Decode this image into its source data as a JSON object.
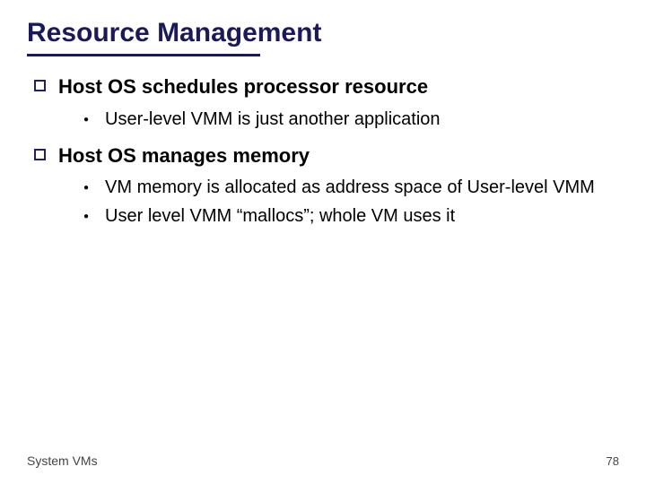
{
  "title": "Resource Management",
  "bullets": {
    "b1": {
      "text": "Host OS schedules processor resource",
      "subs": {
        "s1": "User-level VMM is just another application"
      }
    },
    "b2": {
      "text": "Host OS manages memory",
      "subs": {
        "s1": "VM memory is allocated as address space of User-level VMM",
        "s2": "User level VMM “mallocs”; whole VM uses it"
      }
    }
  },
  "footer": {
    "left": "System VMs",
    "page": "78"
  }
}
